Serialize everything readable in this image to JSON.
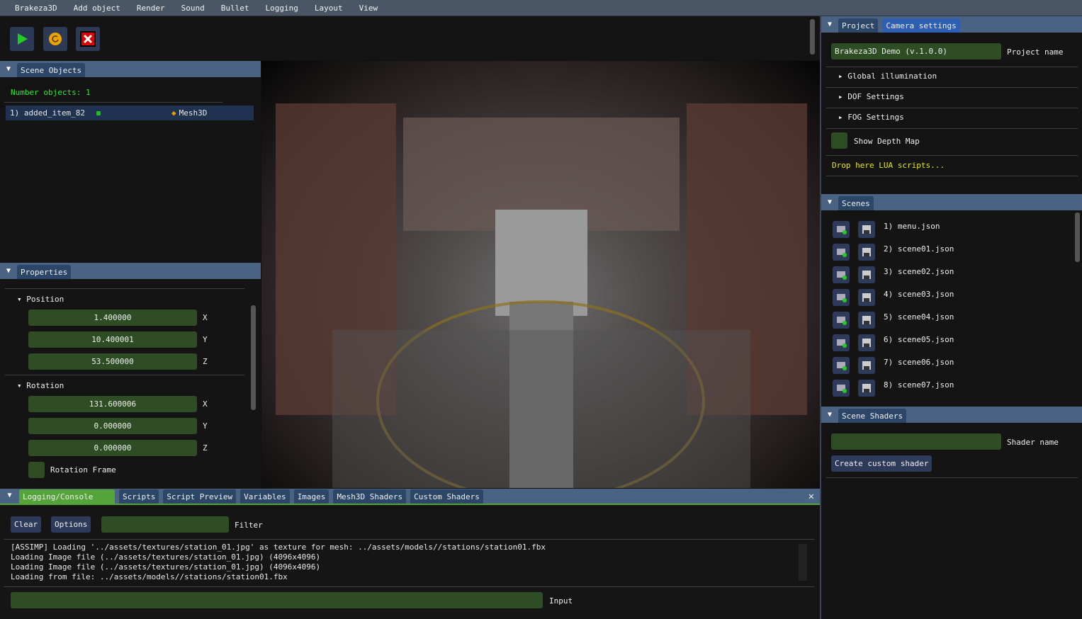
{
  "menu": [
    "Brakeza3D",
    "Add object",
    "Render",
    "Sound",
    "Bullet",
    "Logging",
    "Layout",
    "View"
  ],
  "toolbar": {
    "play_icon": "play-icon",
    "reload_icon": "reload-icon",
    "stop_icon": "close-icon"
  },
  "scene_objects": {
    "tab": "Scene Objects",
    "count_label": "Number objects: 1",
    "items": [
      {
        "name": "1) added_item_82",
        "type": "Mesh3D"
      }
    ]
  },
  "properties": {
    "tab": "Properties",
    "position": {
      "label": "Position",
      "x": "1.400000",
      "y": "10.400001",
      "z": "53.500000"
    },
    "rotation": {
      "label": "Rotation",
      "x": "131.600006",
      "y": "0.000000",
      "z": "0.000000"
    },
    "axis": {
      "x": "X",
      "y": "Y",
      "z": "Z"
    },
    "rotation_frame": "Rotation Frame"
  },
  "project": {
    "tabs": [
      "Project",
      "Camera settings"
    ],
    "name_value": "Brakeza3D Demo (v.1.0.0)",
    "name_label": "Project name",
    "sections": [
      "Global illumination",
      "DOF Settings",
      "FOG Settings"
    ],
    "show_depth_map": "Show Depth Map",
    "drop_lua": "Drop here LUA scripts..."
  },
  "scenes": {
    "tab": "Scenes",
    "items": [
      "1) menu.json",
      "2) scene01.json",
      "3) scene02.json",
      "4) scene03.json",
      "5) scene04.json",
      "6) scene05.json",
      "7) scene06.json",
      "8) scene07.json"
    ]
  },
  "scene_shaders": {
    "tab": "Scene Shaders",
    "shader_name_label": "Shader name",
    "shader_name_value": "",
    "create_button": "Create custom shader"
  },
  "console": {
    "tabs": [
      "Logging/Console",
      "Scripts",
      "Script Preview",
      "Variables",
      "Images",
      "Mesh3D Shaders",
      "Custom Shaders"
    ],
    "clear": "Clear",
    "options": "Options",
    "filter_label": "Filter",
    "filter_value": "",
    "input_label": "Input",
    "input_value": "",
    "log": [
      "[ASSIMP] Loading '../assets/textures/station_01.jpg' as texture for mesh: ../assets/models//stations/station01.fbx",
      "Loading Image file (../assets/textures/station_01.jpg) (4096x4096)",
      "Loading Image file (../assets/textures/station_01.jpg) (4096x4096)",
      "Loading from file: ../assets/models//stations/station01.fbx"
    ]
  },
  "colors": {
    "accent_green": "#55a43a",
    "field_green": "#2e4d24",
    "header": "#4a6383",
    "lua_text": "#e8e800",
    "count_text": "#2ee82e"
  }
}
